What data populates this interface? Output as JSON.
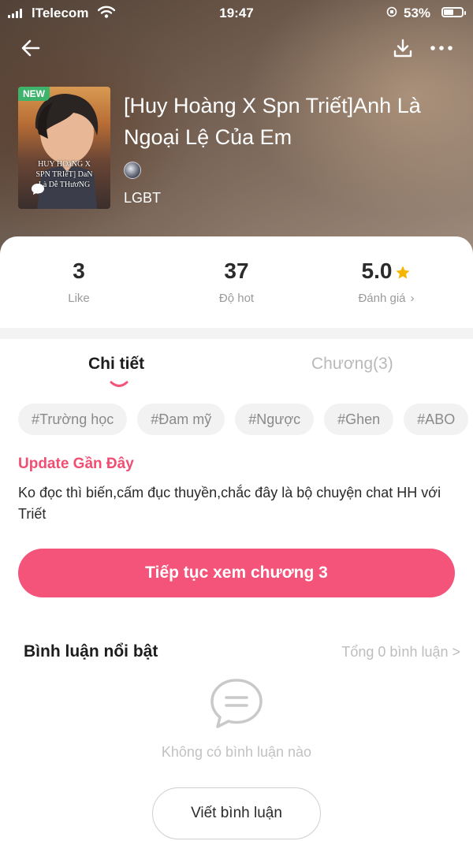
{
  "status_bar": {
    "carrier": "lTelecom",
    "time": "19:47",
    "battery_percent": "53%"
  },
  "book": {
    "badge": "NEW",
    "cover_text_line1": "HUY HOàNG X",
    "cover_text_line2": "SPN TRIếT] DaN",
    "cover_text_line3": "Là Dễ THươNG",
    "title": "[Huy Hoàng X Spn Triết]Anh Là Ngoại Lệ Của Em",
    "category": "LGBT"
  },
  "stats": {
    "likes_value": "3",
    "likes_label": "Like",
    "hot_value": "37",
    "hot_label": "Độ hot",
    "rating_value": "5.0",
    "rating_label": "Đánh giá",
    "rating_chevron": "›"
  },
  "tabs": {
    "details": "Chi tiết",
    "chapters": "Chương(3)"
  },
  "tags": [
    "#Trường học",
    "#Đam mỹ",
    "#Ngược",
    "#Ghen",
    "#ABO"
  ],
  "update": {
    "title": "Update Gần Đây",
    "text": "Ko đọc thì biến,cấm đục thuyền,chắc đây là bộ chuyện chat HH với Triết"
  },
  "continue_button": "Tiếp tục xem chương 3",
  "comments": {
    "title": "Bình luận nổi bật",
    "total": "Tổng 0 bình luận >",
    "empty_text": "Không có bình luận nào",
    "write_button": "Viết bình luận"
  },
  "colors": {
    "accent": "#f4547a",
    "update_title": "#f04e72",
    "star": "#f7b500",
    "new_badge": "#3db36b"
  },
  "icons": {
    "back": "arrow-left-icon",
    "download": "download-icon",
    "more": "more-horizontal-icon",
    "star": "star-icon",
    "empty_comments": "chat-bubble-icon"
  }
}
